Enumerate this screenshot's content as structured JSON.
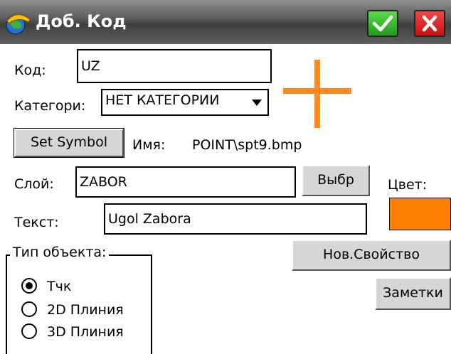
{
  "window": {
    "title": "Доб. Код"
  },
  "form": {
    "code_label": "Код:",
    "code_value": "UZ",
    "category_label": "Категори:",
    "category_value": "НЕТ КАТЕГОРИИ",
    "set_symbol_label": "Set Symbol",
    "name_label": "Имя:",
    "name_value": "POINT\\spt9.bmp",
    "layer_label": "Слой:",
    "layer_value": "ZABOR",
    "select_label": "Выбр",
    "color_label": "Цвет:",
    "text_label": "Текст:",
    "text_value": "Ugol Zabora",
    "new_property_label": "Нов.Свойство",
    "notes_label": "Заметки"
  },
  "object_type": {
    "title": "Тип объекта:",
    "options": [
      {
        "label": "Тчк",
        "checked": true
      },
      {
        "label": "2D Плиния",
        "checked": false
      },
      {
        "label": "3D Плиния",
        "checked": false
      }
    ]
  },
  "colors": {
    "symbol": "#ff8c1a",
    "layer_color": "#ff8000",
    "ok_button": "#2db52a",
    "close_button": "#dc2020"
  },
  "icons": {
    "app": "helmet-globe-icon",
    "ok": "checkmark-icon",
    "close": "close-icon",
    "dropdown": "triangle-down-icon",
    "symbol_preview": "plus-cross-icon"
  }
}
